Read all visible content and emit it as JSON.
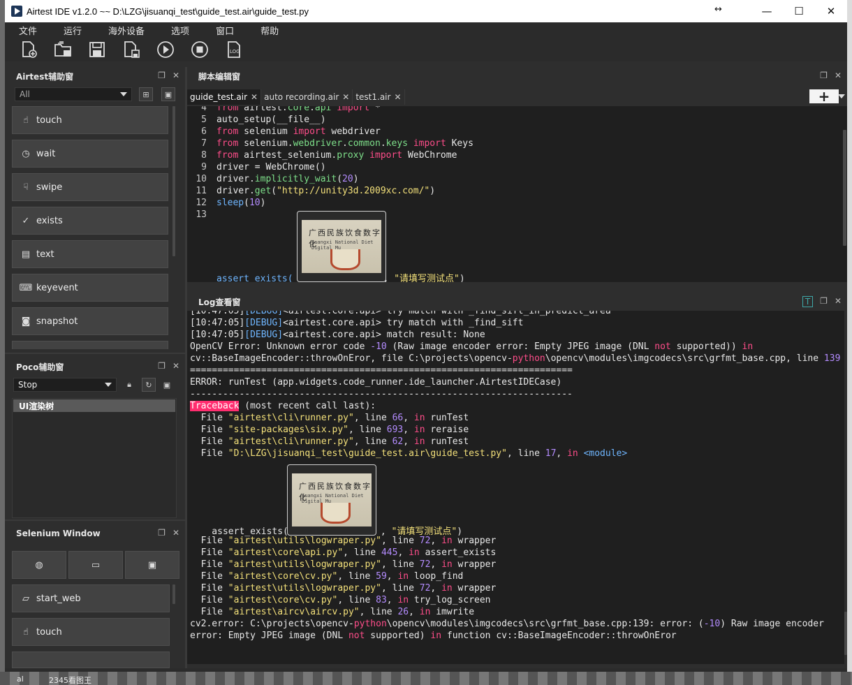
{
  "window": {
    "title": "Airtest IDE v1.2.0 ~~ D:\\LZG\\jisuanqi_test\\guide_test.air\\guide_test.py",
    "resize_glyph": "↔",
    "minimize": "—",
    "maximize": "☐",
    "close": "✕"
  },
  "menu": [
    "文件",
    "运行",
    "海外设备",
    "选项",
    "窗口",
    "帮助"
  ],
  "toolbar": {
    "icons": [
      "new-file-icon",
      "open-folder-icon",
      "save-icon",
      "save-as-icon",
      "run-icon",
      "stop-icon",
      "log-icon"
    ],
    "log_label": "LOG"
  },
  "airtest_panel": {
    "title": "Airtest辅助窗",
    "filter_value": "All",
    "buttons": [
      {
        "label": "touch",
        "icon": "hand-icon"
      },
      {
        "label": "wait",
        "icon": "clock-icon"
      },
      {
        "label": "swipe",
        "icon": "swipe-hand-icon"
      },
      {
        "label": "exists",
        "icon": "check-circle-icon"
      },
      {
        "label": "text",
        "icon": "text-box-icon"
      },
      {
        "label": "keyevent",
        "icon": "keyboard-icon"
      },
      {
        "label": "snapshot",
        "icon": "camera-icon"
      }
    ]
  },
  "poco_panel": {
    "title": "Poco辅助窗",
    "mode_value": "Stop",
    "tree_root": "UI渲染树"
  },
  "selenium_panel": {
    "title": "Selenium Window",
    "icon_buttons": [
      "globe-icon",
      "monitor-icon",
      "video-camera-icon"
    ],
    "buttons": [
      {
        "label": "start_web",
        "icon": "inbox-icon"
      },
      {
        "label": "touch",
        "icon": "hand-icon"
      }
    ]
  },
  "editor_panel": {
    "title": "脚本编辑窗",
    "tabs": [
      {
        "label": "guide_test.air",
        "active": true
      },
      {
        "label": "auto recording.air",
        "active": false
      },
      {
        "label": "test1.air",
        "active": false
      }
    ],
    "plus": "+",
    "close_glyph": "✕",
    "thumb_text_1": "广西民族饮食数字化",
    "thumb_text_2": "Guangxi National Diet Digital Mu",
    "lines": [
      {
        "n": "4",
        "parts": [
          [
            "kw",
            "from"
          ],
          [
            "plain",
            " airtest."
          ],
          [
            "fn",
            "core"
          ],
          [
            "plain",
            "."
          ],
          [
            "fn",
            "api"
          ],
          [
            "plain",
            " "
          ],
          [
            "kw",
            "import"
          ],
          [
            "plain",
            " *"
          ]
        ]
      },
      {
        "n": "5",
        "parts": [
          [
            "plain",
            "auto_setup(__file__)"
          ]
        ]
      },
      {
        "n": "6",
        "parts": [
          [
            "kw",
            "from"
          ],
          [
            "plain",
            " selenium "
          ],
          [
            "kw",
            "import"
          ],
          [
            "plain",
            " webdriver"
          ]
        ]
      },
      {
        "n": "7",
        "parts": [
          [
            "kw",
            "from"
          ],
          [
            "plain",
            " selenium."
          ],
          [
            "fn",
            "webdriver"
          ],
          [
            "plain",
            "."
          ],
          [
            "fn",
            "common"
          ],
          [
            "plain",
            "."
          ],
          [
            "fn",
            "keys"
          ],
          [
            "plain",
            " "
          ],
          [
            "kw",
            "import"
          ],
          [
            "plain",
            " Keys"
          ]
        ]
      },
      {
        "n": "8",
        "parts": [
          [
            "kw",
            "from"
          ],
          [
            "plain",
            " airtest_selenium."
          ],
          [
            "fn",
            "proxy"
          ],
          [
            "plain",
            " "
          ],
          [
            "kw",
            "import"
          ],
          [
            "plain",
            " WebChrome"
          ]
        ]
      },
      {
        "n": "9",
        "parts": [
          [
            "plain",
            "driver = WebChrome()"
          ]
        ]
      },
      {
        "n": "10",
        "parts": [
          [
            "plain",
            "driver."
          ],
          [
            "fn",
            "implicitly_wait"
          ],
          [
            "plain",
            "("
          ],
          [
            "num",
            "20"
          ],
          [
            "plain",
            ")"
          ]
        ]
      },
      {
        "n": "11",
        "parts": [
          [
            "plain",
            "driver."
          ],
          [
            "fn",
            "get"
          ],
          [
            "plain",
            "("
          ],
          [
            "str",
            "\"http://unity3d.2009xc.com/\""
          ],
          [
            "plain",
            ")"
          ]
        ]
      },
      {
        "n": "12",
        "parts": [
          [
            "bi",
            "sleep"
          ],
          [
            "plain",
            "("
          ],
          [
            "num",
            "10"
          ],
          [
            "plain",
            ")"
          ]
        ]
      },
      {
        "n": "13",
        "parts": []
      }
    ],
    "assert_line": {
      "fn": "assert_exists(",
      "tail": ", ",
      "str": "\"请填写测试点\"",
      "close": ")"
    }
  },
  "log_panel": {
    "title": "Log查看窗",
    "lines": [
      [
        [
          "plain",
          "[10:47:05]"
        ],
        [
          "dbg",
          "[DEBUG]"
        ],
        [
          "plain",
          "<airtest.core.api> try match with _find_sift_in_predict_area"
        ]
      ],
      [
        [
          "plain",
          "[10:47:05]"
        ],
        [
          "dbg",
          "[DEBUG]"
        ],
        [
          "plain",
          "<airtest.core.api> try match with _find_sift"
        ]
      ],
      [
        [
          "plain",
          "[10:47:05]"
        ],
        [
          "dbg",
          "[DEBUG]"
        ],
        [
          "plain",
          "<airtest.core.api> match result: None"
        ]
      ],
      [
        [
          "plain",
          "OpenCV Error: Unknown error code "
        ],
        [
          "num",
          "-10"
        ],
        [
          "plain",
          " (Raw image encoder error: Empty JPEG image (DNL "
        ],
        [
          "kw",
          "not"
        ],
        [
          "plain",
          " supported)) "
        ],
        [
          "kw",
          "in"
        ]
      ],
      [
        [
          "plain",
          "cv::BaseImageEncoder::throwOnEror, file C:\\projects\\opencv-"
        ],
        [
          "kw",
          "python"
        ],
        [
          "plain",
          "\\opencv\\modules\\imgcodecs\\src\\grfmt_base.cpp, line "
        ],
        [
          "num",
          "139"
        ]
      ],
      [
        [
          "plain",
          "======================================================================"
        ]
      ],
      [
        [
          "plain",
          "ERROR: runTest (app.widgets.code_runner.ide_launcher.AirtestIDECase)"
        ]
      ],
      [
        [
          "plain",
          "----------------------------------------------------------------------"
        ]
      ],
      [
        [
          "tb",
          "Traceback"
        ],
        [
          "plain",
          " (most recent call last):"
        ]
      ],
      [
        [
          "plain",
          "  File "
        ],
        [
          "str",
          "\"airtest\\cli\\runner.py\""
        ],
        [
          "plain",
          ", line "
        ],
        [
          "num",
          "66"
        ],
        [
          "plain",
          ", "
        ],
        [
          "kw",
          "in"
        ],
        [
          "plain",
          " runTest"
        ]
      ],
      [
        [
          "plain",
          "  File "
        ],
        [
          "str",
          "\"site-packages\\six.py\""
        ],
        [
          "plain",
          ", line "
        ],
        [
          "num",
          "693"
        ],
        [
          "plain",
          ", "
        ],
        [
          "kw",
          "in"
        ],
        [
          "plain",
          " reraise"
        ]
      ],
      [
        [
          "plain",
          "  File "
        ],
        [
          "str",
          "\"airtest\\cli\\runner.py\""
        ],
        [
          "plain",
          ", line "
        ],
        [
          "num",
          "62"
        ],
        [
          "plain",
          ", "
        ],
        [
          "kw",
          "in"
        ],
        [
          "plain",
          " runTest"
        ]
      ],
      [
        [
          "plain",
          "  File "
        ],
        [
          "str",
          "\"D:\\LZG\\jisuanqi_test\\guide_test.air\\guide_test.py\""
        ],
        [
          "plain",
          ", line "
        ],
        [
          "num",
          "17"
        ],
        [
          "plain",
          ", "
        ],
        [
          "kw",
          "in"
        ],
        [
          "plain",
          " "
        ],
        [
          "bi",
          "<module>"
        ]
      ]
    ],
    "assert_line": {
      "fn": "    assert_exists(",
      "tail": ", ",
      "str": "\"请填写测试点\"",
      "close": ")"
    },
    "lines2": [
      [
        [
          "plain",
          "  File "
        ],
        [
          "str",
          "\"airtest\\utils\\logwraper.py\""
        ],
        [
          "plain",
          ", line "
        ],
        [
          "num",
          "72"
        ],
        [
          "plain",
          ", "
        ],
        [
          "kw",
          "in"
        ],
        [
          "plain",
          " wrapper"
        ]
      ],
      [
        [
          "plain",
          "  File "
        ],
        [
          "str",
          "\"airtest\\core\\api.py\""
        ],
        [
          "plain",
          ", line "
        ],
        [
          "num",
          "445"
        ],
        [
          "plain",
          ", "
        ],
        [
          "kw",
          "in"
        ],
        [
          "plain",
          " assert_exists"
        ]
      ],
      [
        [
          "plain",
          "  File "
        ],
        [
          "str",
          "\"airtest\\utils\\logwraper.py\""
        ],
        [
          "plain",
          ", line "
        ],
        [
          "num",
          "72"
        ],
        [
          "plain",
          ", "
        ],
        [
          "kw",
          "in"
        ],
        [
          "plain",
          " wrapper"
        ]
      ],
      [
        [
          "plain",
          "  File "
        ],
        [
          "str",
          "\"airtest\\core\\cv.py\""
        ],
        [
          "plain",
          ", line "
        ],
        [
          "num",
          "59"
        ],
        [
          "plain",
          ", "
        ],
        [
          "kw",
          "in"
        ],
        [
          "plain",
          " loop_find"
        ]
      ],
      [
        [
          "plain",
          "  File "
        ],
        [
          "str",
          "\"airtest\\utils\\logwraper.py\""
        ],
        [
          "plain",
          ", line "
        ],
        [
          "num",
          "72"
        ],
        [
          "plain",
          ", "
        ],
        [
          "kw",
          "in"
        ],
        [
          "plain",
          " wrapper"
        ]
      ],
      [
        [
          "plain",
          "  File "
        ],
        [
          "str",
          "\"airtest\\core\\cv.py\""
        ],
        [
          "plain",
          ", line "
        ],
        [
          "num",
          "83"
        ],
        [
          "plain",
          ", "
        ],
        [
          "kw",
          "in"
        ],
        [
          "plain",
          " try_log_screen"
        ]
      ],
      [
        [
          "plain",
          "  File "
        ],
        [
          "str",
          "\"airtest\\aircv\\aircv.py\""
        ],
        [
          "plain",
          ", line "
        ],
        [
          "num",
          "26"
        ],
        [
          "plain",
          ", "
        ],
        [
          "kw",
          "in"
        ],
        [
          "plain",
          " imwrite"
        ]
      ],
      [
        [
          "plain",
          "cv2.error: C:\\projects\\opencv-"
        ],
        [
          "kw",
          "python"
        ],
        [
          "plain",
          "\\opencv\\modules\\imgcodecs\\src\\grfmt_base.cpp:139: error: ("
        ],
        [
          "num",
          "-10"
        ],
        [
          "plain",
          ") Raw image encoder"
        ]
      ],
      [
        [
          "plain",
          "error: Empty JPEG image (DNL "
        ],
        [
          "kw",
          "not"
        ],
        [
          "plain",
          " supported) "
        ],
        [
          "kw",
          "in"
        ],
        [
          "plain",
          " function cv::BaseImageEncoder::throwOnEror"
        ]
      ]
    ]
  },
  "taskbar": {
    "item1": "al",
    "item2": "2345看图王"
  }
}
